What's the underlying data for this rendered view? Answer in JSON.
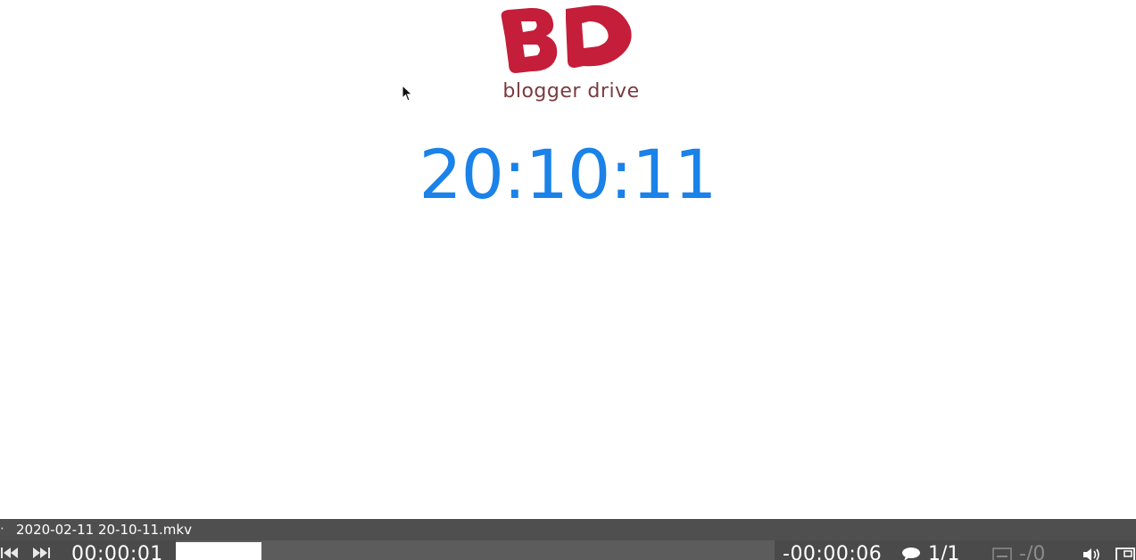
{
  "video": {
    "logo_text": "blogger drive",
    "logo_color": "#c41e3a",
    "clock_text": "20:10:11",
    "clock_color": "#1a82e8"
  },
  "osd": {
    "file_name": "2020-02-11 20-10-11.mkv",
    "elapsed": "00:00:01",
    "remaining": "-00:00:06",
    "progress_fraction": 0.143,
    "audio_track": "1/1",
    "subtitle_track": "-/0",
    "icons": {
      "prev": "skip-back-icon",
      "next": "skip-forward-icon",
      "audio": "speech-bubble-icon",
      "subtitle": "subtitle-icon",
      "volume": "speaker-icon",
      "fullscreen": "fullscreen-icon"
    }
  }
}
